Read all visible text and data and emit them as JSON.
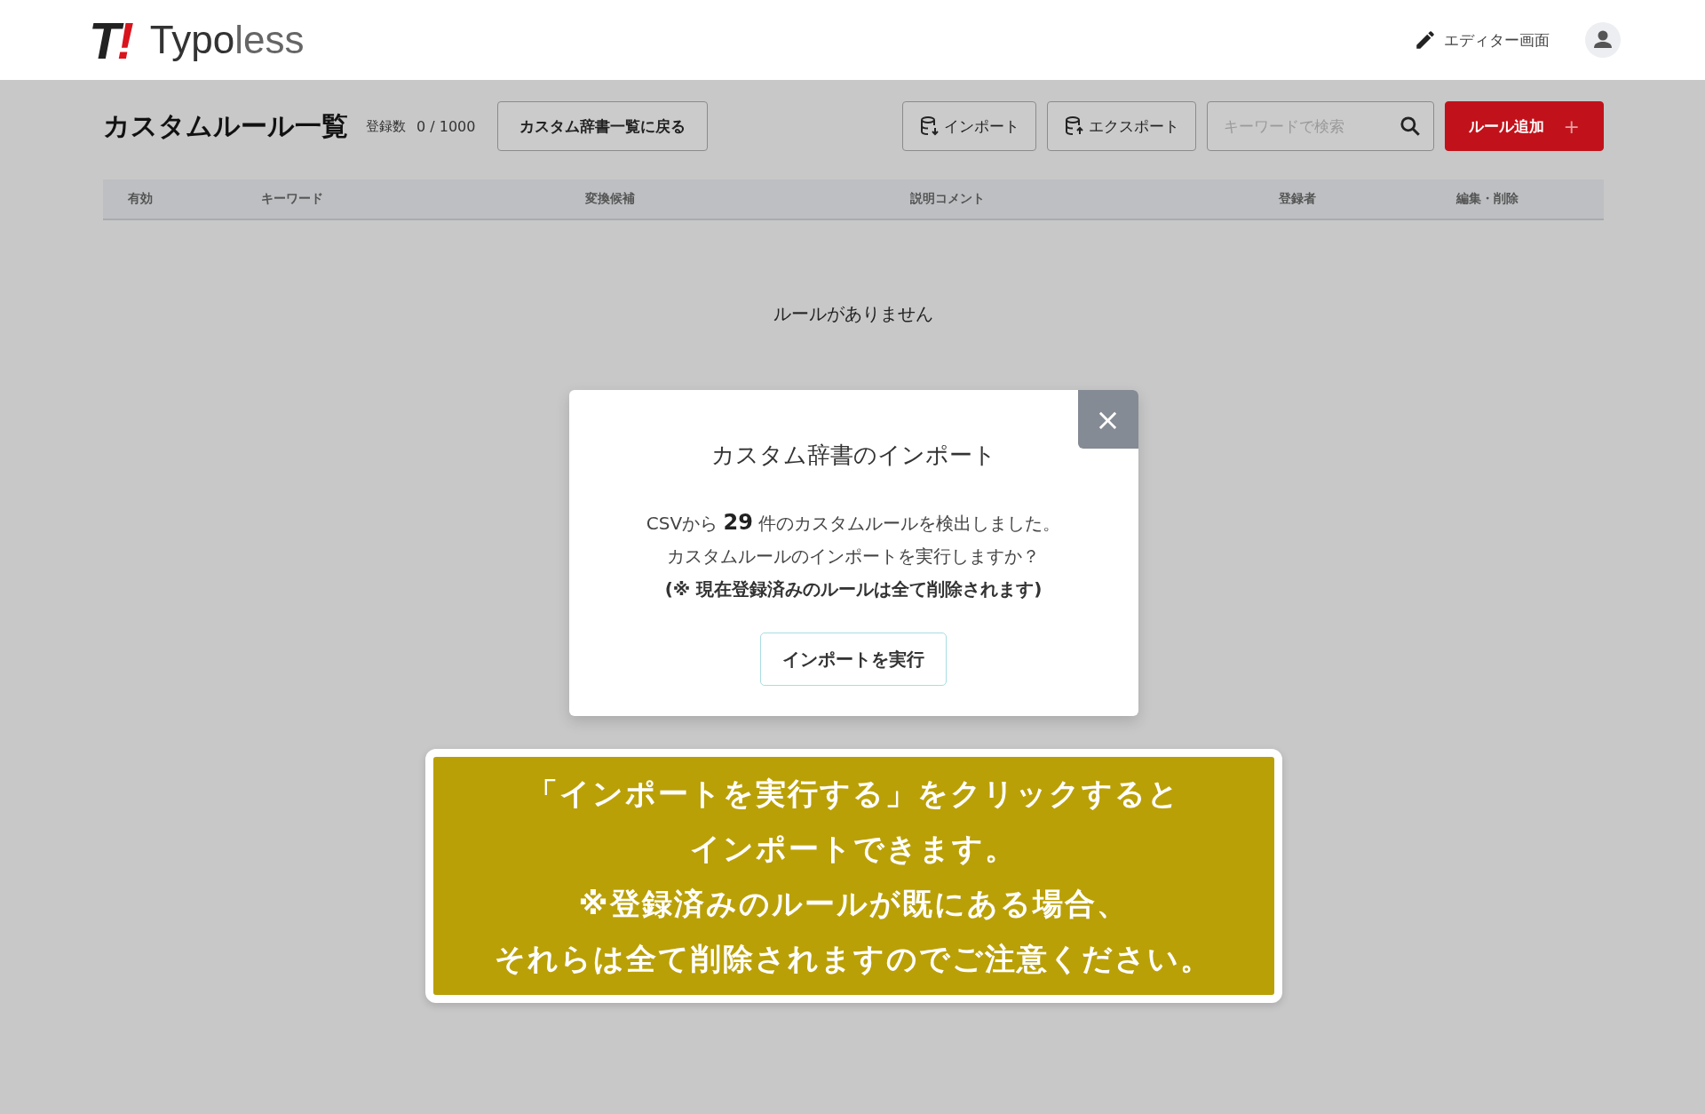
{
  "header": {
    "logo_mark": "T",
    "logo_accent": "!",
    "logo_text": "**Typo**less",
    "editor_link": "エディター画面"
  },
  "toolbar": {
    "title": "カスタムルール一覧",
    "count_label": "登録数",
    "count": "0 / 1000",
    "back_button": "カスタム辞書一覧に戻る",
    "import_button": "インポート",
    "export_button": "エクスポート",
    "search": {
      "placeholder": "キーワードで検索"
    },
    "add_button": "ルール追加",
    "add_icon": "+"
  },
  "table": {
    "columns": [
      "有効",
      "キーワード",
      "変換候補",
      "説明コメント",
      "登録者",
      "編集・削除"
    ],
    "empty_message": "ルールがありません"
  },
  "modal": {
    "title": "カスタム辞書のインポート",
    "close": "×",
    "lines": [
      "CSVから **29** 件のカスタムルールを検出しました。",
      "カスタムルールのインポートを実行しますか？"
    ],
    "warning": "(※ 現在登録済みのルールは全て削除されます)",
    "button": "インポートを実行"
  },
  "callout": {
    "lines": [
      "「インポートを実行する」をクリックすると",
      "インポートできます。",
      "※登録済みのルールが既にある場合、",
      "それらは全て削除されますのでご注意ください。"
    ]
  }
}
